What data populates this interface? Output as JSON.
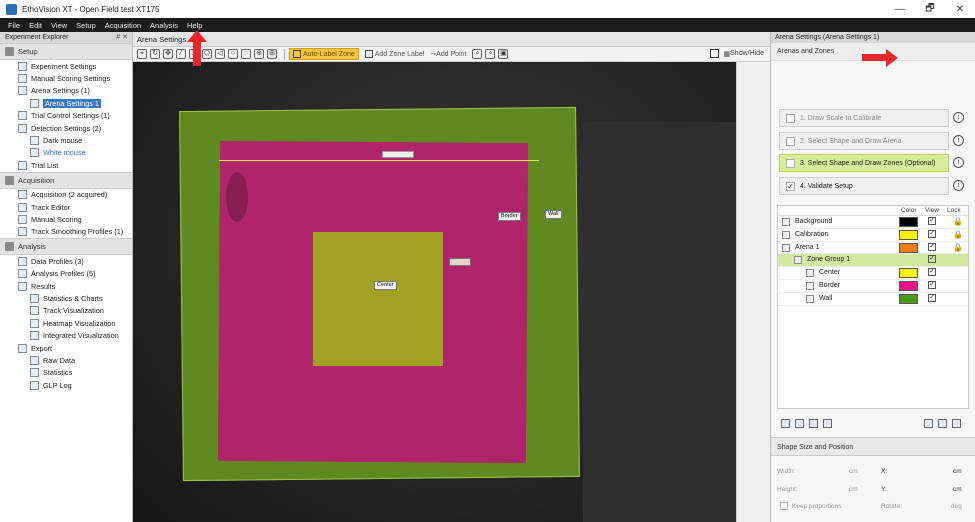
{
  "window": {
    "title": "EthoVision XT - Open Field test XT175",
    "minimize": "—",
    "maximize": "🗗",
    "close": "✕"
  },
  "menu": [
    "File",
    "Edit",
    "View",
    "Setup",
    "Acquisition",
    "Analysis",
    "Help"
  ],
  "explorer": {
    "title": "Experiment Explorer",
    "pin": "# ✕",
    "sections": [
      {
        "name": "Setup",
        "items": [
          {
            "label": "Experiment Settings",
            "level": 1
          },
          {
            "label": "Manual Scoring Settings",
            "level": 1
          },
          {
            "label": "Arena Settings (1)",
            "level": 1
          },
          {
            "label": "Arena Settings 1",
            "level": 2,
            "selected": true
          },
          {
            "label": "Trial Control Settings (1)",
            "level": 1
          },
          {
            "label": "Detection Settings (2)",
            "level": 1
          },
          {
            "label": "Dark mouse",
            "level": 2
          },
          {
            "label": "White mouse",
            "level": 2,
            "link": true
          },
          {
            "label": "Trial List",
            "level": 1
          }
        ]
      },
      {
        "name": "Acquisition",
        "items": [
          {
            "label": "Acquisition (2 acquired)",
            "level": 1
          },
          {
            "label": "Track Editor",
            "level": 1
          },
          {
            "label": "Manual Scoring",
            "level": 1
          },
          {
            "label": "Track Smoothing Profiles (1)",
            "level": 1
          }
        ]
      },
      {
        "name": "Analysis",
        "items": [
          {
            "label": "Data Profiles (3)",
            "level": 1
          },
          {
            "label": "Analysis Profiles (5)",
            "level": 1
          },
          {
            "label": "Results",
            "level": 1
          },
          {
            "label": "Statistics & Charts",
            "level": 2
          },
          {
            "label": "Track Visualization",
            "level": 2
          },
          {
            "label": "Heatmap Visualization",
            "level": 2
          },
          {
            "label": "Integrated Visualization",
            "level": 2
          },
          {
            "label": "Export",
            "level": 1
          },
          {
            "label": "Raw Data",
            "level": 2
          },
          {
            "label": "Statistics",
            "level": 2
          },
          {
            "label": "GLP Log",
            "level": 2
          }
        ]
      }
    ]
  },
  "document": {
    "tab": "Arena Settings",
    "toolbar": {
      "auto_label_zone": "Auto-Label Zone",
      "add_zone_label": "Add Zone Label",
      "add_point": "Add Point",
      "show_hide": "Show/Hide"
    },
    "zone_labels": {
      "border": "Border",
      "wall": "Wall",
      "center": "Center"
    }
  },
  "panel": {
    "title": "Arena Settings (Arena Settings 1)",
    "subtitle": "Arenas and Zones",
    "steps": [
      {
        "label": "1. Draw Scale to Calibrate",
        "state": "disabled"
      },
      {
        "label": "2. Select Shape and Draw Arena",
        "state": "disabled"
      },
      {
        "label": "3. Select Shape and Draw Zones (Optional)",
        "state": "active"
      },
      {
        "label": "4. Validate Setup",
        "state": "done"
      }
    ],
    "zone_table": {
      "headers": {
        "color": "Color",
        "view": "View",
        "lock": "Lock"
      },
      "rows": [
        {
          "name": "Background",
          "indent": 0,
          "color": "#000000",
          "view": true,
          "lock": true
        },
        {
          "name": "Calibration",
          "indent": 0,
          "color": "#f5f500",
          "view": true,
          "lock": true
        },
        {
          "name": "Arena 1",
          "indent": 0,
          "color": "#f07d14",
          "view": true,
          "lock": true
        },
        {
          "name": "Zone Group 1",
          "indent": 1,
          "color": "",
          "view": true,
          "lock": false,
          "selected": true
        },
        {
          "name": "Center",
          "indent": 2,
          "color": "#f5f500",
          "view": true,
          "lock": false
        },
        {
          "name": "Border",
          "indent": 2,
          "color": "#ee1188",
          "view": true,
          "lock": false
        },
        {
          "name": "Wall",
          "indent": 2,
          "color": "#4c9a1c",
          "view": true,
          "lock": false
        }
      ]
    },
    "shape": {
      "title": "Shape Size and Position",
      "width": "Width:",
      "height": "Height:",
      "x": "X:",
      "y": "Y:",
      "unit_cm": "cm",
      "unit_deg": "deg",
      "rotate": "Rotate:",
      "keep": "Keep proportions"
    }
  },
  "colors": {
    "accent_red": "#e5262b",
    "active_step": "#d9ec9b",
    "wall": "#5f8a22",
    "border": "#b0246a",
    "center": "#a3a123"
  }
}
